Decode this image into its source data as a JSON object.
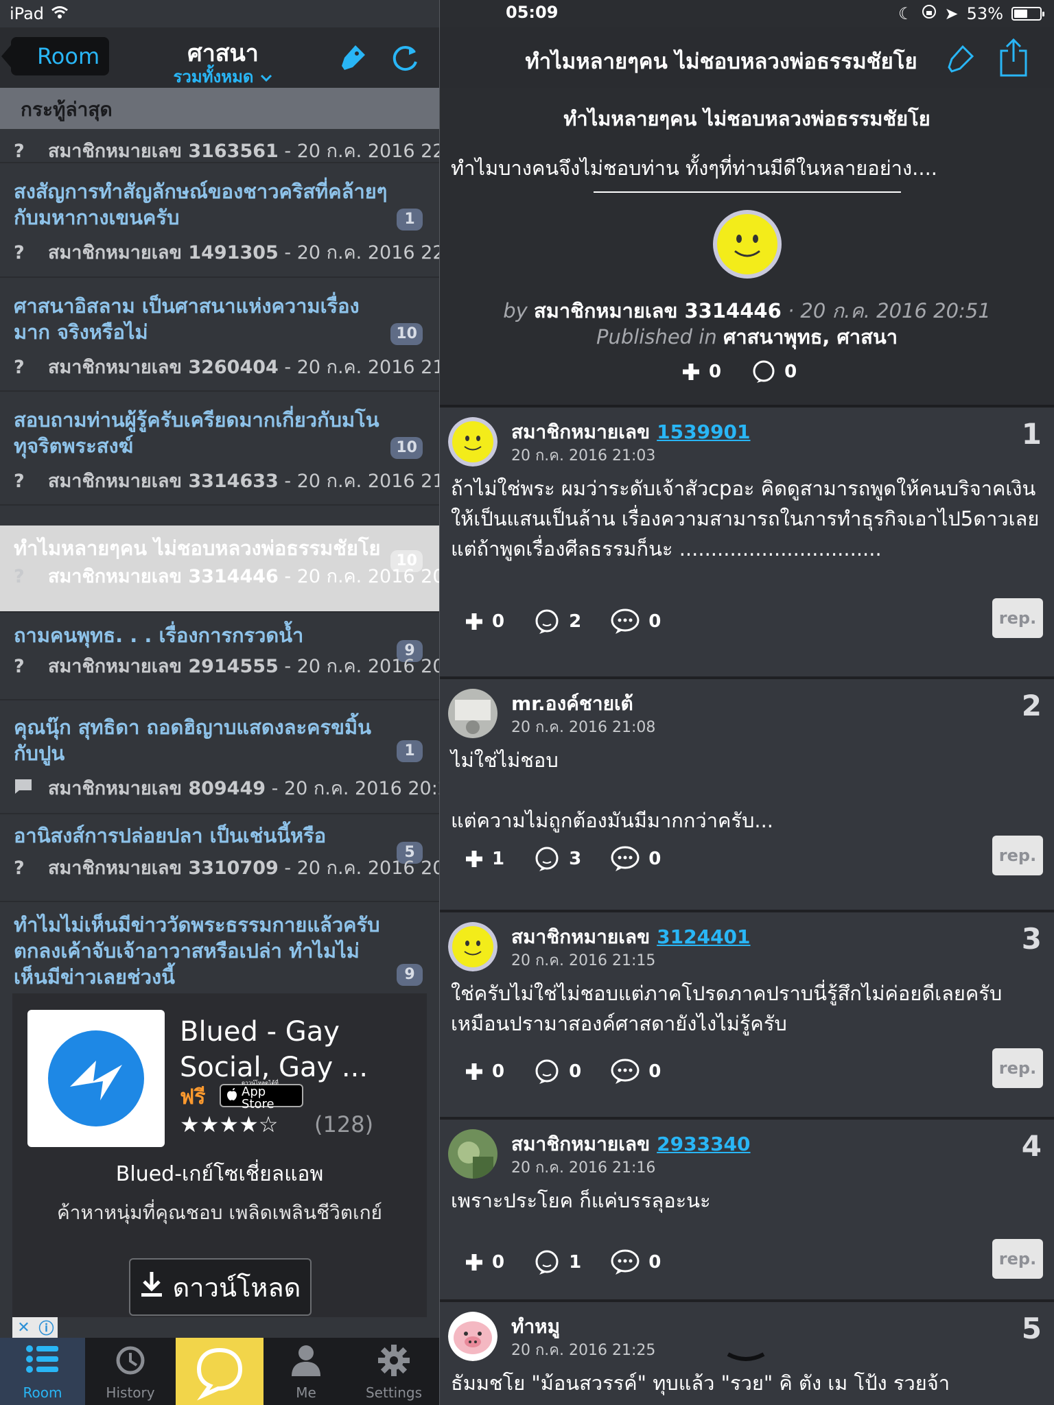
{
  "status_bar": {
    "device": "iPad",
    "time": "05:09",
    "battery": "53%",
    "battery_level": 0.53
  },
  "left_header": {
    "back_label": "Room",
    "title": "ศาสนา",
    "subtitle": "รวมทั้งหมด"
  },
  "section_label": "กระทู้ล่าสุด",
  "topics": [
    {
      "title": "",
      "author": "สมาชิกหมายเลข 3163561",
      "date": "- 20 ก.ค. 2016 22:3",
      "count": "",
      "type": "question"
    },
    {
      "title": "สงสัญการทำสัญลักษณ์ของชาวคริสที่คล้ายๆกับมหากางเขนครับ",
      "author": "สมาชิกหมายเลข 1491305",
      "date": "- 20 ก.ค. 2016 22:3",
      "count": "1",
      "type": "question"
    },
    {
      "title": "ศาสนาอิสลาม เป็นศาสนาแห่งความเรื่องมาก จริงหรือไม่",
      "author": "สมาชิกหมายเลข 3260404",
      "date": "- 20 ก.ค. 2016 21:",
      "count": "10",
      "type": "question"
    },
    {
      "title": "สอบถามท่านผู้รู้ครับเครียดมากเกี่ยวกับมโนทุจริตพระสงฆ์",
      "author": "สมาชิกหมายเลข 3314633",
      "date": "- 20 ก.ค. 2016 21:",
      "count": "10",
      "type": "question"
    },
    {
      "title": "ทำไมหลายๆคน ไม่ชอบหลวงพ่อธรรมชัยโย",
      "author": "สมาชิกหมายเลข 3314446",
      "date": "- 20 ก.ค. 2016 20:",
      "count": "10",
      "type": "question"
    },
    {
      "title": "ถามคนพุทธ. . . เรื่องการกรวดน้ำ",
      "author": "สมาชิกหมายเลข 2914555",
      "date": "- 20 ก.ค. 2016 20:",
      "count": "9",
      "type": "question"
    },
    {
      "title": "คุณนุ๊ก สุทธิดา ถอดฮิญาบแสดงละครขมิ้นกับปูน",
      "author": "สมาชิกหมายเลข 809449",
      "date": "- 20 ก.ค. 2016 20:2",
      "count": "1",
      "type": "chat"
    },
    {
      "title": "อานิสงส์การปล่อยปลา เป็นเช่นนี้หรือ",
      "author": "สมาชิกหมายเลข 3310709",
      "date": "- 20 ก.ค. 2016 20:",
      "count": "5",
      "type": "question"
    },
    {
      "title": "ทำไมไม่เห็นมีข่าววัดพระธรรมกายแล้วครับ ตกลงเค้าจับเจ้าอาวาสหรือเปล่า ทำไมไม่เห็นมีข่าวเลยช่วงนี้",
      "author": "",
      "date": "",
      "count": "9",
      "type": "question"
    }
  ],
  "ad": {
    "title": "Blued - Gay Social, Gay ...",
    "price": "ฟรี",
    "store_label": "App Store",
    "store_small": "ดาวน์โหลดได้ที่",
    "rating": 4,
    "rating_count": "(128)",
    "name": "Blued-เกย์โซเชี่ยลแอพ",
    "description": "ค้าหาหนุ่มที่คุณชอบ เพลิดเพลินชีวิตเกย์",
    "download_label": "ดาวน์โหลด"
  },
  "tabs": [
    {
      "label": "Room",
      "icon": "list-icon",
      "active": true
    },
    {
      "label": "History",
      "icon": "history-icon",
      "active": false
    },
    {
      "label": "",
      "icon": "chat-bubble-icon",
      "active": false
    },
    {
      "label": "Me",
      "icon": "person-icon",
      "active": false
    },
    {
      "label": "Settings",
      "icon": "gear-icon",
      "active": false
    }
  ],
  "right_header": {
    "title": "ทำไมหลายๆคน ไม่ชอบหลวงพ่อธรรมชัยโย"
  },
  "post": {
    "title": "ทำไมหลายๆคน ไม่ชอบหลวงพ่อธรรมชัยโย",
    "body": "ทำไมบางคนจึงไม่ชอบท่าน ทั้งๆที่ท่านมีดีในหลายอย่าง....",
    "by_prefix": "by",
    "author": "สมาชิกหมายเลข 3314446",
    "date": "· 20 ก.ค. 2016 20:51",
    "published_prefix": "Published in",
    "published_in": "ศาสนาพุทธ, ศาสนา",
    "plus": "0",
    "comments": "0"
  },
  "comments": [
    {
      "num": "1",
      "name": "สมาชิกหมายเลข",
      "member_id": "1539901",
      "time": "20 ก.ค. 2016 21:03",
      "text": "ถ้าไม่ใช่พระ ผมว่าระดับเจ้าสัวcpอะ คิดดูสามารถพูดให้คนบริจาคเงินให้เป็นแสนเป็นล้าน เรื่องความสามารถในการทำธุรกิจเอาไป5ดาวเลย แต่ถ้าพูดเรื่องศีลธรรมก็นะ ................................",
      "plus": "0",
      "replies": "2",
      "messages": "0",
      "avatar": "smiley"
    },
    {
      "num": "2",
      "name": "mr.องค์ชายเต้",
      "member_id": "",
      "time": "20 ก.ค. 2016 21:08",
      "text": "ไม่ใช่ไม่ชอบ\n\nแต่ความไม่ถูกต้องมันมีมากกว่าครับ...",
      "plus": "1",
      "replies": "3",
      "messages": "0",
      "avatar": "photo-gray"
    },
    {
      "num": "3",
      "name": "สมาชิกหมายเลข",
      "member_id": "3124401",
      "time": "20 ก.ค. 2016 21:15",
      "text": "ใช่ครับไม่ใช่ไม่ชอบแต่ภาคโปรดภาคปราบนี่รู้สึกไม่ค่อยดีเลยครับเหมือนปรามาสองค์ศาสดายังไงไม่รู้ครับ",
      "plus": "0",
      "replies": "0",
      "messages": "0",
      "avatar": "smiley"
    },
    {
      "num": "4",
      "name": "สมาชิกหมายเลข",
      "member_id": "2933340",
      "time": "20 ก.ค. 2016 21:16",
      "text": "เพราะประโยค ก็แค่บรรลุอะนะ",
      "plus": "0",
      "replies": "1",
      "messages": "0",
      "avatar": "photo-green"
    },
    {
      "num": "5",
      "name": "ทำหมู",
      "member_id": "",
      "time": "20 ก.ค. 2016 21:25",
      "text": "ธัมมชโย \"ม้อนสวรรค์\" ทุบแล้ว \"รวย\" คิ ตัง เม โป้ง รวยจ้า",
      "plus": "",
      "replies": "",
      "messages": "",
      "avatar": "pig"
    }
  ],
  "reply_label": "rep.",
  "colors": {
    "accent": "#29b6f6",
    "bg": "#2b2d31",
    "panel": "#35383e",
    "ad_price": "#ff9a2e",
    "tab_highlight": "#f2d54a"
  }
}
